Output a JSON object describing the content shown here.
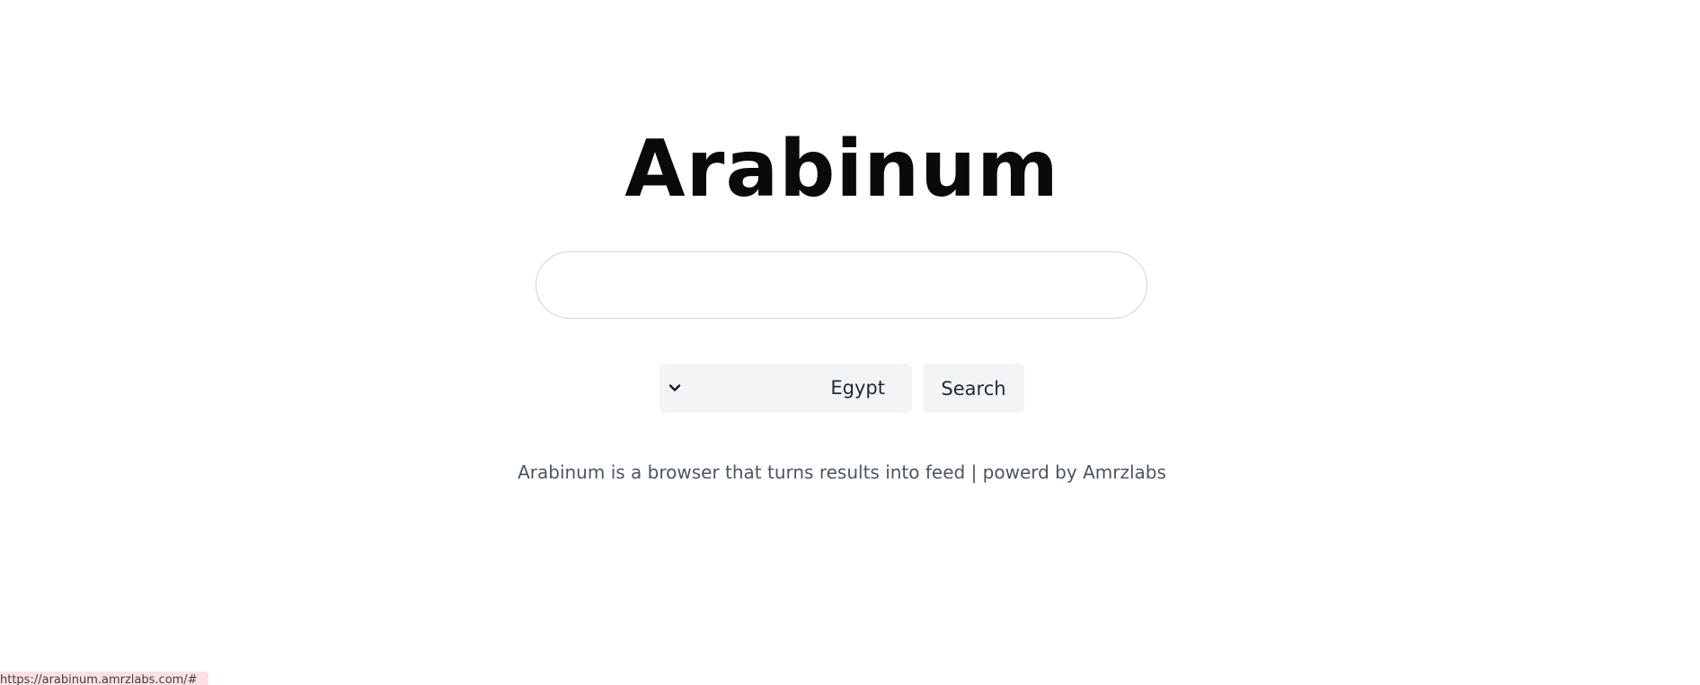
{
  "app": {
    "title": "Arabinum"
  },
  "search": {
    "value": "",
    "placeholder": "",
    "button_label": "Search"
  },
  "country_select": {
    "selected": "Egypt",
    "icon": "chevron-down-icon"
  },
  "footer": {
    "text": "Arabinum is a browser that turns results into feed | powerd by Amrzlabs"
  },
  "status_bar": {
    "url": "https://arabinum.amrzlabs.com/#"
  }
}
